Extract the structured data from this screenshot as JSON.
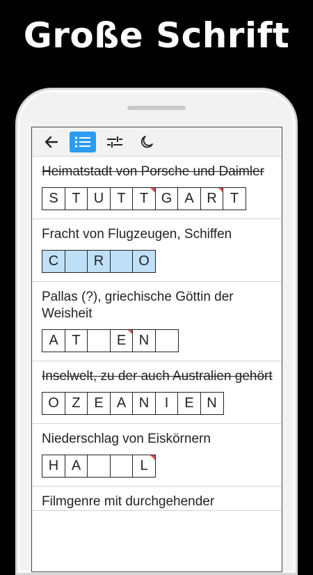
{
  "headline": "Große Schrift",
  "toolbar": {
    "back_icon": "arrow-left-icon",
    "list_icon": "list-icon",
    "settings_icon": "sliders-icon",
    "night_icon": "moon-icon",
    "active_color": "#2b9cf0"
  },
  "clues": [
    {
      "text": "Heimatstadt von Porsche und Daimler",
      "solved": true,
      "cells": [
        "S",
        "T",
        "U",
        "T",
        "T",
        "G",
        "A",
        "R",
        "T"
      ],
      "marked": [
        4,
        7
      ],
      "highlight": false
    },
    {
      "text": "Fracht von Flugzeugen, Schiffen",
      "solved": false,
      "cells": [
        "C",
        "",
        "R",
        "",
        "O"
      ],
      "marked": [],
      "highlight": true
    },
    {
      "text": "Pallas (?), griechische Göttin der Weisheit",
      "solved": false,
      "cells": [
        "A",
        "T",
        "",
        "E",
        "N",
        ""
      ],
      "marked": [
        3
      ],
      "highlight": false
    },
    {
      "text": "Inselwelt, zu der auch Australien gehört",
      "solved": true,
      "cells": [
        "O",
        "Z",
        "E",
        "A",
        "N",
        "I",
        "E",
        "N"
      ],
      "marked": [],
      "highlight": false
    },
    {
      "text": "Niederschlag von Eiskörnern",
      "solved": false,
      "cells": [
        "H",
        "A",
        "",
        "",
        "L"
      ],
      "marked": [
        4
      ],
      "highlight": false
    },
    {
      "text": "Filmgenre mit durchgehender",
      "solved": false,
      "cells": [],
      "marked": [],
      "highlight": false
    }
  ],
  "colors": {
    "highlight_cell": "#bfe0f7",
    "corner_mark": "#d9534f"
  }
}
